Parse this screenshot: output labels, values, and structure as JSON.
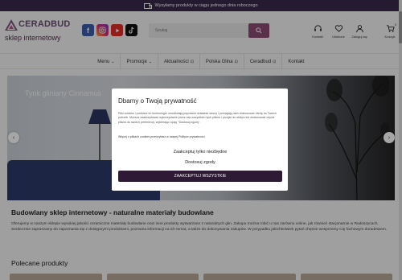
{
  "topbar": {
    "text": "Wysyłamy produkty w ciągu jednego dnia roboczego",
    "icon": "truck-icon"
  },
  "header": {
    "logo_name": "CERADBUD",
    "logo_tagline": "sklep internetowy",
    "socials": [
      "facebook-icon",
      "instagram-icon",
      "youtube-icon",
      "tiktok-icon"
    ],
    "search": {
      "placeholder": "Szukaj",
      "icon": "search-icon"
    },
    "icons": [
      {
        "label": "Kontakt",
        "icon": "headset-icon"
      },
      {
        "label": "Ulubione",
        "icon": "heart-icon"
      },
      {
        "label": "Zaloguj się",
        "icon": "user-icon"
      }
    ],
    "cart": {
      "label": "Koszyk",
      "count": "0"
    }
  },
  "nav": {
    "items": [
      {
        "label": "Menu",
        "chevron": "⌄"
      },
      {
        "label": "Promocje",
        "chevron": "⌄"
      },
      {
        "label": "Aktualności",
        "chevron": "⊡"
      },
      {
        "label": "Polska Glina",
        "chevron": "⊡"
      },
      {
        "label": "Ceradbud",
        "chevron": "⊡"
      },
      {
        "label": "Kontakt",
        "chevron": ""
      }
    ]
  },
  "hero": {
    "caption": "Tynk gliniany Cinnamus"
  },
  "modal": {
    "title": "Dbamy o Twoją prywatność",
    "body": "Pliki cookies i podobne im technologie umożliwiają poprawne działanie strony i pomagają nam dostosować ofertę do Twoich potrzeb. Możesz zaakceptować wykorzystanie przez nas wszystkich tych plików i przejść do sklepu lub dostosować użycie plików do swoich preferencji, wybierając opcję \"Dostosuj zgody\".",
    "more": "Więcej o plikach cookies przeczytasz w naszej Polityce prywatności",
    "btn_necessary": "Zaakceptuj tylko niezbędne",
    "btn_customize": "Dostosuj zgody",
    "btn_accept_all": "ZAAKCEPTUJ WSZYSTKIE"
  },
  "content": {
    "title": "Budowlany sklep internetowy - naturalne materiały budowlane",
    "text": "Oferujemy w naszym sklepie wysokiej jakości ceramiczne materiały budowlane oraz inne produkty wytwarzane z naturalnych glin. Zakupu można robić u nas zarówno online, jak również stacjonarnie w Radoszycach. Serdecznie zapraszamy do zapoznania się z dostępnymi produktami, poznania informacji na ich temat, a także do dokonywania zakupów. W przypadku jakichkolwiek pytań chętnie wesprzemy Cię fachowym doradztwem.",
    "featured_title": "Polecane produkty"
  }
}
